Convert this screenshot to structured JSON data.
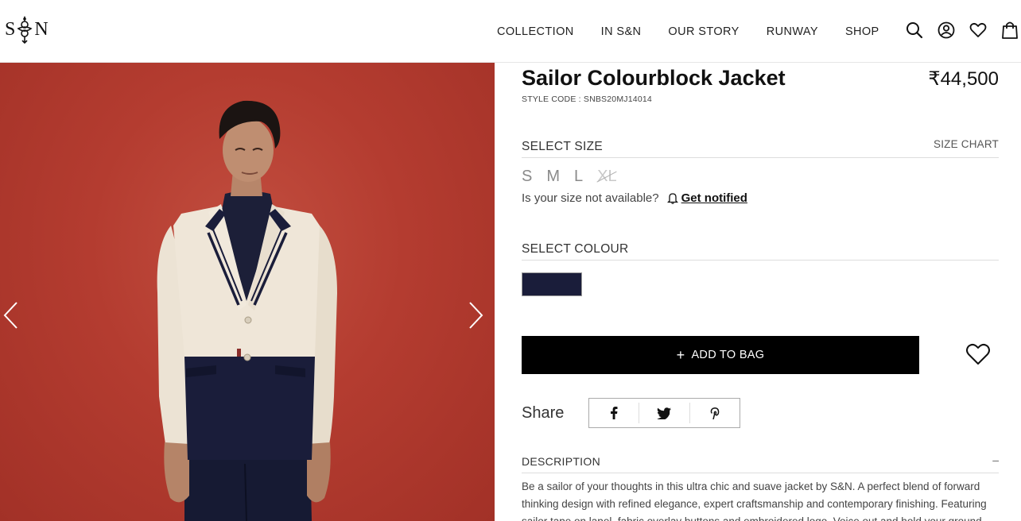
{
  "brand": {
    "logo_left": "S",
    "logo_right": "N"
  },
  "nav": {
    "items": [
      "COLLECTION",
      "IN S&N",
      "OUR STORY",
      "RUNWAY",
      "SHOP"
    ]
  },
  "header_icons": [
    "search-icon",
    "account-icon",
    "heart-icon",
    "bag-icon"
  ],
  "product": {
    "title": "Sailor Colourblock Jacket",
    "price": "₹44,500",
    "style_code": "STYLE CODE : SNBS20MJ14014",
    "select_size_label": "SELECT SIZE",
    "size_chart_label": "SIZE CHART",
    "sizes": [
      {
        "label": "S",
        "available": true
      },
      {
        "label": "M",
        "available": true
      },
      {
        "label": "L",
        "available": true
      },
      {
        "label": "XL",
        "available": false
      }
    ],
    "size_question": "Is your size not available?",
    "get_notified": "Get notified",
    "select_colour_label": "SELECT COLOUR",
    "colour_swatch": "#1a1d3a",
    "add_to_bag": "ADD TO BAG",
    "add_prefix": "+",
    "share_label": "Share",
    "share_icons": [
      "facebook-icon",
      "twitter-icon",
      "pinterest-icon"
    ],
    "description_label": "DESCRIPTION",
    "description_toggle": "–",
    "description_text": "Be a sailor of your thoughts in this ultra chic and suave jacket by S&N. A perfect blend of forward thinking design with refined elegance, expert craftsmanship and contemporary finishing. Featuring sailor tape on lapel, fabric overlay buttons and embroidered logo. Voice out and hold your ground"
  },
  "colors": {
    "background_image": "#b43c30",
    "jacket_cream": "#efe6d8",
    "navy": "#1a1d3a",
    "button_black": "#000000"
  }
}
